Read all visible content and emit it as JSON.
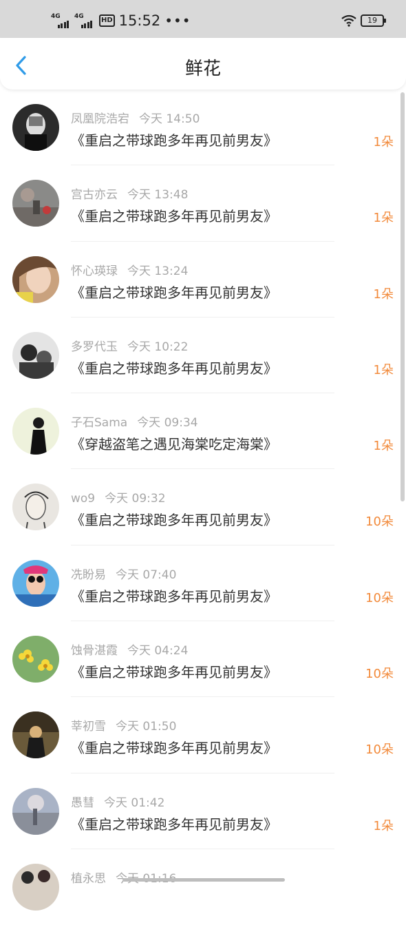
{
  "status_bar": {
    "time": "15:52",
    "dots": "•••",
    "network1": "4G",
    "network2": "4G",
    "hd": "HD",
    "battery": "19"
  },
  "header": {
    "title": "鲜花",
    "back_icon": "chevron-left-icon"
  },
  "colors": {
    "accent": "#f28a3b",
    "back": "#2f9be8"
  },
  "items": [
    {
      "name": "凤凰院浩宕",
      "time": "今天 14:50",
      "book": "《重启之带球跑多年再见前男友》",
      "count": "1朵"
    },
    {
      "name": "宫古亦云",
      "time": "今天 13:48",
      "book": "《重启之带球跑多年再见前男友》",
      "count": "1朵"
    },
    {
      "name": "怀心瑛琭",
      "time": "今天 13:24",
      "book": "《重启之带球跑多年再见前男友》",
      "count": "1朵"
    },
    {
      "name": "多罗代玉",
      "time": "今天 10:22",
      "book": "《重启之带球跑多年再见前男友》",
      "count": "1朵"
    },
    {
      "name": "子石Sama",
      "time": "今天 09:34",
      "book": "《穿越盗笔之遇见海棠吃定海棠》",
      "count": "1朵"
    },
    {
      "name": "wo9",
      "time": "今天 09:32",
      "book": "《重启之带球跑多年再见前男友》",
      "count": "10朵"
    },
    {
      "name": "冼盼易",
      "time": "今天 07:40",
      "book": "《重启之带球跑多年再见前男友》",
      "count": "10朵"
    },
    {
      "name": "蚀骨湛霞",
      "time": "今天 04:24",
      "book": "《重启之带球跑多年再见前男友》",
      "count": "10朵"
    },
    {
      "name": "莘初雪",
      "time": "今天 01:50",
      "book": "《重启之带球跑多年再见前男友》",
      "count": "10朵"
    },
    {
      "name": "愚彗",
      "time": "今天 01:42",
      "book": "《重启之带球跑多年再见前男友》",
      "count": "1朵"
    },
    {
      "name": "植永思",
      "time": "今天 01:16",
      "book": "",
      "count": ""
    }
  ]
}
